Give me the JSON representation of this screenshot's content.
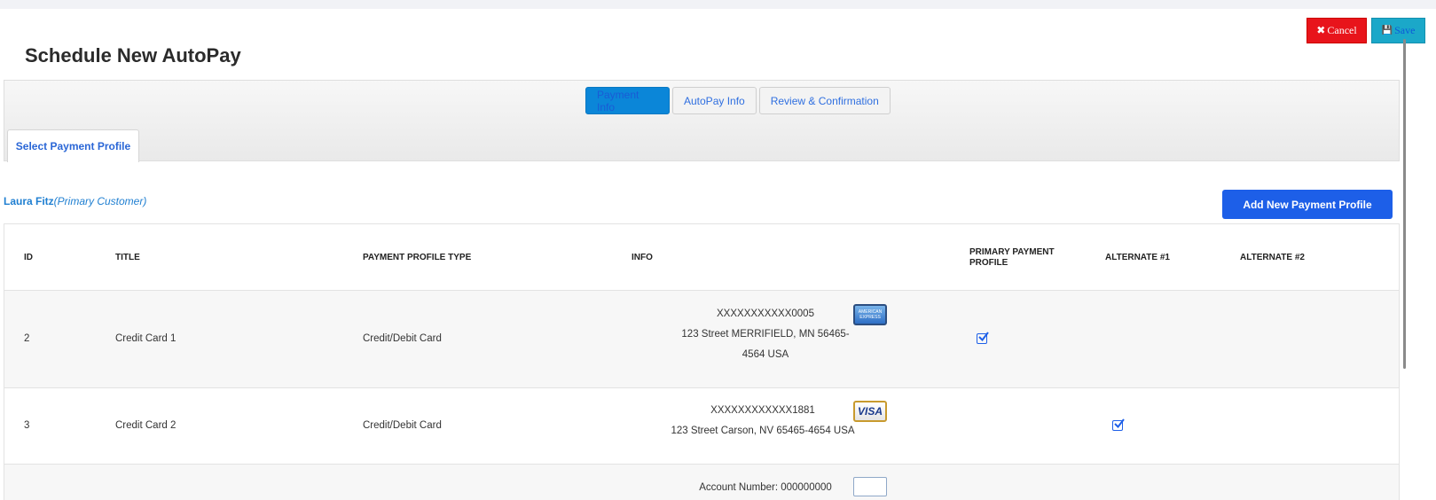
{
  "page": {
    "title": "Schedule New AutoPay"
  },
  "actions": {
    "cancel_label": "Cancel",
    "save_label": "Save"
  },
  "wizard": {
    "steps": [
      {
        "label": "Payment Info",
        "active": true
      },
      {
        "label": "AutoPay Info",
        "active": false
      },
      {
        "label": "Review & Confirmation",
        "active": false
      }
    ],
    "subtab": "Select Payment Profile"
  },
  "customer": {
    "name": "Laura Fitz",
    "role": "(Primary Customer)"
  },
  "add_button": "Add New Payment Profile",
  "table": {
    "headers": [
      "ID",
      "TITLE",
      "PAYMENT PROFILE TYPE",
      "INFO",
      "PRIMARY PAYMENT PROFILE",
      "ALTERNATE #1",
      "ALTERNATE #2"
    ],
    "rows": [
      {
        "id": "2",
        "title": "Credit Card 1",
        "type": "Credit/Debit Card",
        "info_line1": "XXXXXXXXXXX0005",
        "info_line2": "123 Street MERRIFIELD, MN 56465-",
        "info_line3": "4564 USA",
        "card": "amex",
        "card_text": "AMERICAN EXPRESS",
        "primary": true,
        "alt1": false,
        "alt2": false
      },
      {
        "id": "3",
        "title": "Credit Card 2",
        "type": "Credit/Debit Card",
        "info_line1": "XXXXXXXXXXXX1881",
        "info_line2": "123 Street Carson, NV 65465-4654 USA",
        "card": "visa",
        "card_text": "VISA",
        "primary": false,
        "alt1": true,
        "alt2": false
      },
      {
        "info_line1": "Account Number: 000000000",
        "card": "bank"
      }
    ]
  },
  "colors": {
    "cancel": "#e8141b",
    "save": "#1ba8c9",
    "accent": "#1d5fe8",
    "step_active": "#0b86d8"
  },
  "icons": {
    "cancel": "close-icon",
    "save": "save-icon",
    "checkbox": "checkbox-checked-icon"
  }
}
